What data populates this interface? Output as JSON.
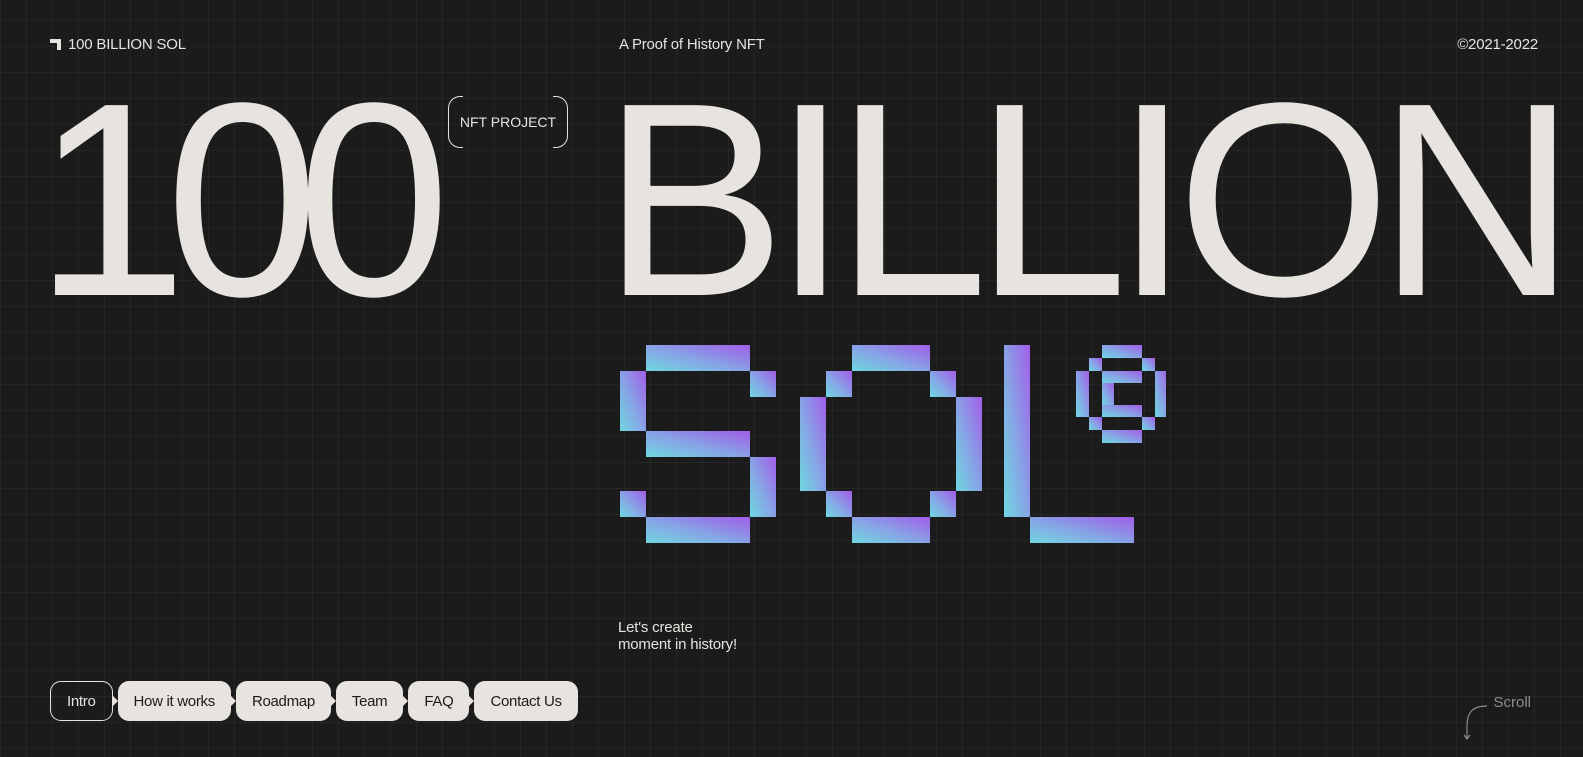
{
  "header": {
    "brand": "100 BILLION SOL",
    "tagline": "A Proof of History NFT",
    "copyright": "©2021-2022"
  },
  "hero": {
    "number": "100",
    "badge": "NFT PROJECT",
    "word": "BILLION",
    "logo_text": "SOL",
    "logo_gradient": [
      "#6fd8e0",
      "#86a6e6",
      "#a25de8"
    ]
  },
  "slogan": {
    "line1": "Let's create",
    "line2": "moment in history!"
  },
  "nav": {
    "items": [
      {
        "label": "Intro",
        "active": true
      },
      {
        "label": "How it works",
        "active": false
      },
      {
        "label": "Roadmap",
        "active": false
      },
      {
        "label": "Team",
        "active": false
      },
      {
        "label": "FAQ",
        "active": false
      },
      {
        "label": "Contact Us",
        "active": false
      }
    ]
  },
  "scroll": {
    "label": "Scroll",
    "icon": "curved-arrow-down-icon"
  },
  "colors": {
    "background": "#1b1b1b",
    "foreground": "#e7e3df",
    "muted": "#8f8c89"
  }
}
